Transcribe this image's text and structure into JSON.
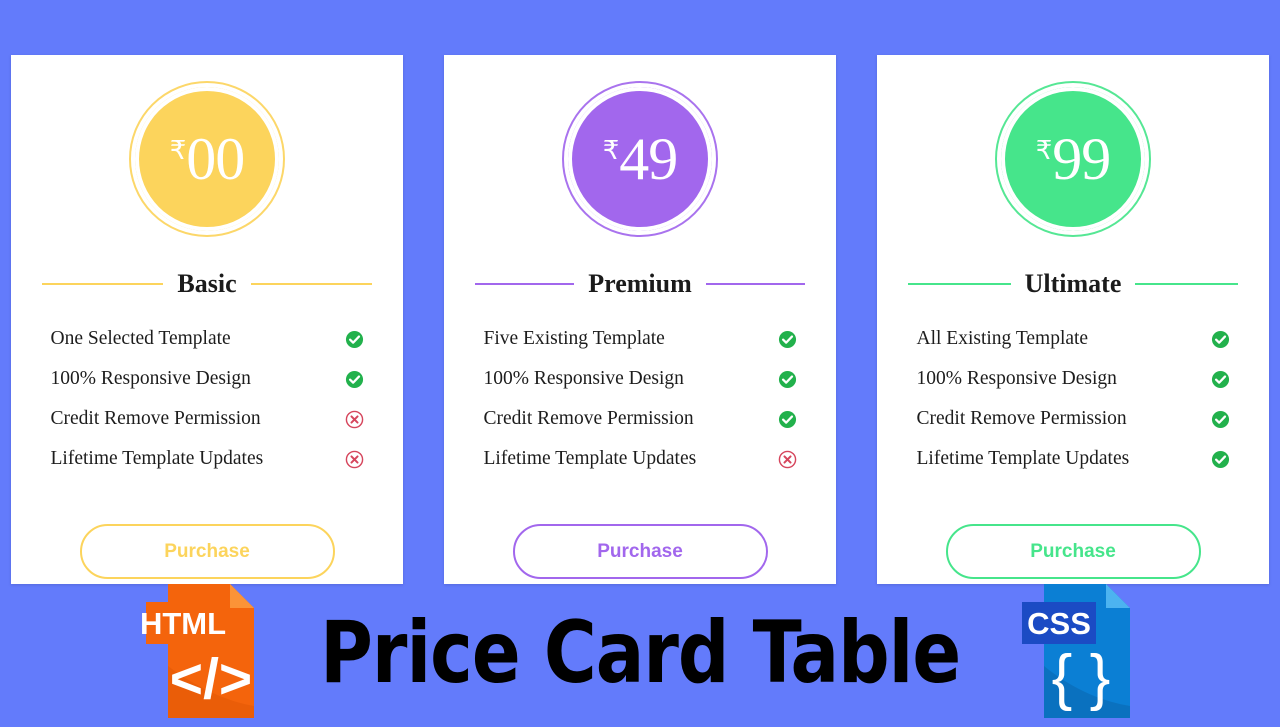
{
  "theme": {
    "background": "#637bfb",
    "card_background": "#ffffff",
    "text": "#1d1d1d",
    "check_color": "#22b14c",
    "cross_color": "#d6455c"
  },
  "banner": {
    "title": "Price Card Table",
    "html_icon_label": "HTML",
    "html_icon_glyph": "</>",
    "html_icon_color": "#f4640c",
    "css_icon_label": "CSS",
    "css_icon_glyph": "{ }",
    "css_icon_color": "#0b7fd4"
  },
  "cards": [
    {
      "plan": "Basic",
      "currency": "₹",
      "price": "00",
      "accent": "#fcd45c",
      "purchase_label": "Purchase",
      "features": [
        {
          "label": "One Selected Template",
          "included": true
        },
        {
          "label": "100% Responsive Design",
          "included": true
        },
        {
          "label": "Credit Remove Permission",
          "included": false
        },
        {
          "label": "Lifetime Template Updates",
          "included": false
        }
      ]
    },
    {
      "plan": "Premium",
      "currency": "₹",
      "price": "49",
      "accent": "#a267ed",
      "purchase_label": "Purchase",
      "features": [
        {
          "label": "Five Existing Template",
          "included": true
        },
        {
          "label": "100% Responsive Design",
          "included": true
        },
        {
          "label": "Credit Remove Permission",
          "included": true
        },
        {
          "label": "Lifetime Template Updates",
          "included": false
        }
      ]
    },
    {
      "plan": "Ultimate",
      "currency": "₹",
      "price": "99",
      "accent": "#46e58b",
      "purchase_label": "Purchase",
      "features": [
        {
          "label": "All Existing Template",
          "included": true
        },
        {
          "label": "100% Responsive Design",
          "included": true
        },
        {
          "label": "Credit Remove Permission",
          "included": true
        },
        {
          "label": "Lifetime Template Updates",
          "included": true
        }
      ]
    }
  ]
}
